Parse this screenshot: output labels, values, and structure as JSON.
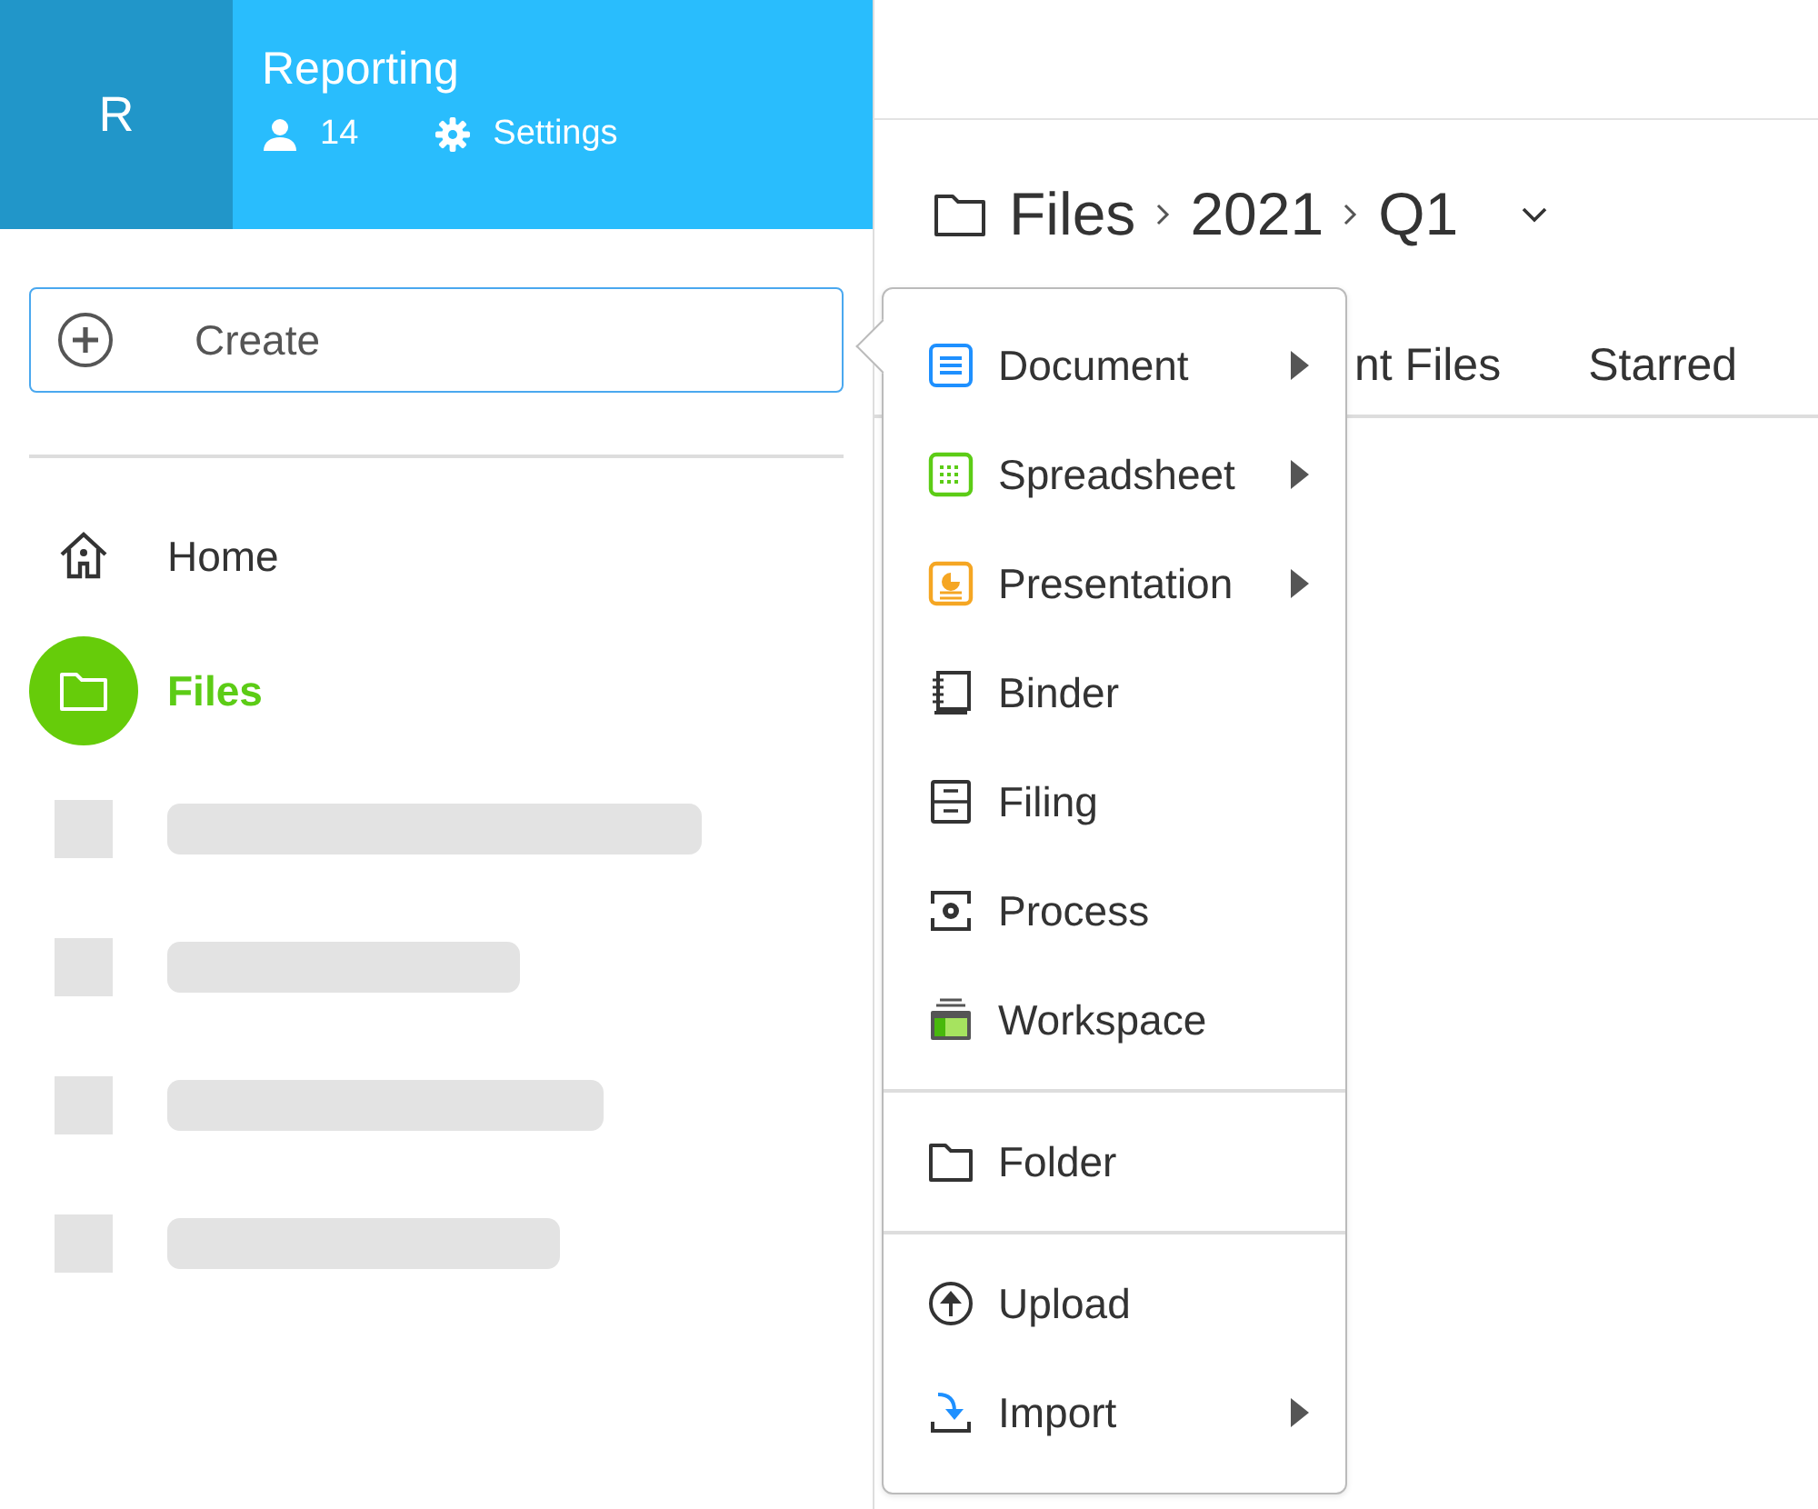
{
  "team": {
    "initial": "R",
    "name": "Reporting",
    "members": "14",
    "settings": "Settings"
  },
  "create": {
    "label": "Create"
  },
  "nav": [
    {
      "label": "Home",
      "selected": false
    },
    {
      "label": "Files",
      "selected": true
    }
  ],
  "skeleton_rows": [
    {
      "kind": "placeholder"
    },
    {
      "kind": "placeholder"
    },
    {
      "kind": "placeholder"
    },
    {
      "kind": "placeholder"
    }
  ],
  "breadcrumb": [
    "Files",
    "2021",
    "Q1"
  ],
  "tabs": [
    "nt Files",
    "Starred"
  ],
  "menu": {
    "sections": [
      [
        {
          "label": "Document",
          "submenu": true
        },
        {
          "label": "Spreadsheet",
          "submenu": true
        },
        {
          "label": "Presentation",
          "submenu": true
        },
        {
          "label": "Binder",
          "submenu": false
        },
        {
          "label": "Filing",
          "submenu": false
        },
        {
          "label": "Process",
          "submenu": false
        },
        {
          "label": "Workspace",
          "submenu": false
        }
      ],
      [
        {
          "label": "Folder",
          "submenu": false
        }
      ],
      [
        {
          "label": "Upload",
          "submenu": false
        },
        {
          "label": "Import",
          "submenu": true
        }
      ]
    ]
  }
}
